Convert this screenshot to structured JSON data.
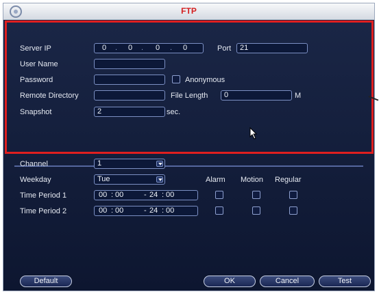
{
  "window": {
    "title": "FTP"
  },
  "form": {
    "server_ip_label": "Server IP",
    "ip": [
      "0",
      "0",
      "0",
      "0"
    ],
    "port_label": "Port",
    "port_value": "21",
    "user_name_label": "User Name",
    "user_name_value": "",
    "password_label": "Password",
    "password_value": "",
    "anonymous_label": "Anonymous",
    "remote_directory_label": "Remote Directory",
    "remote_directory_value": "",
    "file_length_label": "File Length",
    "file_length_value": "0",
    "file_length_unit": "M",
    "snapshot_label": "Snapshot",
    "snapshot_value": "2",
    "snapshot_unit": "sec."
  },
  "schedule": {
    "channel_label": "Channel",
    "channel_value": "1",
    "weekday_label": "Weekday",
    "weekday_value": "Tue",
    "col_alarm": "Alarm",
    "col_motion": "Motion",
    "col_regular": "Regular",
    "periods": [
      {
        "label": "Time Period 1",
        "start_h": "00",
        "start_m": "00",
        "end_h": "24",
        "end_m": "00"
      },
      {
        "label": "Time Period 2",
        "start_h": "00",
        "start_m": "00",
        "end_h": "24",
        "end_m": "00"
      }
    ]
  },
  "buttons": {
    "default": "Default",
    "ok": "OK",
    "cancel": "Cancel",
    "test": "Test"
  },
  "colors": {
    "title": "#d42020",
    "highlight": "#e01f1f",
    "panel": "#101a33"
  },
  "icons": {
    "logo": "logo-icon",
    "cursor": "mouse-cursor-icon"
  }
}
